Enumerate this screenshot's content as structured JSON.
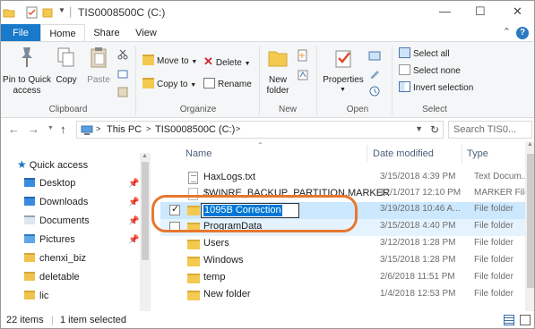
{
  "window": {
    "title": "TIS0008500C (C:)",
    "minimize_glyph": "—",
    "maximize_glyph": "☐",
    "close_glyph": "✕"
  },
  "ribbon_tabs": [
    "File",
    "Home",
    "Share",
    "View"
  ],
  "ribbon": {
    "clipboard": {
      "label": "Clipboard",
      "pin_to_quick_access": "Pin to Quick access",
      "copy": "Copy",
      "paste": "Paste",
      "cut_icon": "scissors-icon"
    },
    "organize": {
      "label": "Organize",
      "move_to": "Move to",
      "copy_to": "Copy to",
      "delete": "Delete",
      "rename": "Rename"
    },
    "new": {
      "label": "New",
      "new_folder": "New folder"
    },
    "open": {
      "label": "Open",
      "properties": "Properties"
    },
    "select": {
      "label": "Select",
      "select_all": "Select all",
      "select_none": "Select none",
      "invert_selection": "Invert selection"
    }
  },
  "address": {
    "crumbs": [
      "This PC",
      "TIS0008500C (C:)"
    ],
    "separator": ">",
    "search_placeholder": "Search TIS0..."
  },
  "navigation_pane": {
    "quick_access": "Quick access",
    "items": [
      {
        "label": "Desktop",
        "pinned": true
      },
      {
        "label": "Downloads",
        "pinned": true
      },
      {
        "label": "Documents",
        "pinned": true
      },
      {
        "label": "Pictures",
        "pinned": true
      },
      {
        "label": "chenxi_biz",
        "pinned": false
      },
      {
        "label": "deletable",
        "pinned": false
      },
      {
        "label": "lic",
        "pinned": false
      }
    ]
  },
  "columns": {
    "name": "Name",
    "date_modified": "Date modified",
    "type": "Type"
  },
  "files": [
    {
      "name": "HaxLogs.txt",
      "date": "3/15/2018 4:39 PM",
      "type": "Text Docum...",
      "kind": "text"
    },
    {
      "name": "$WINRE_BACKUP_PARTITION.MARKER",
      "date": "12/1/2017 12:10 PM",
      "type": "MARKER File",
      "kind": "marker"
    },
    {
      "name": "1095B Correction",
      "date": "3/19/2018 10:46 A...",
      "type": "File folder",
      "kind": "folder",
      "selected": true,
      "renaming": true
    },
    {
      "name": "ProgramData",
      "date": "3/15/2018 4:40 PM",
      "type": "File folder",
      "kind": "folder"
    },
    {
      "name": "Users",
      "date": "3/12/2018 1:28 PM",
      "type": "File folder",
      "kind": "folder"
    },
    {
      "name": "Windows",
      "date": "3/15/2018 1:28 PM",
      "type": "File folder",
      "kind": "folder"
    },
    {
      "name": "temp",
      "date": "2/6/2018 11:51 PM",
      "type": "File folder",
      "kind": "folder"
    },
    {
      "name": "New folder",
      "date": "1/4/2018 12:53 PM",
      "type": "File folder",
      "kind": "folder"
    }
  ],
  "status": {
    "item_count": "22 items",
    "selection": "1 item selected"
  },
  "colors": {
    "accent": "#1979ca",
    "selection": "#cce8ff",
    "annotation": "#e8772e"
  }
}
